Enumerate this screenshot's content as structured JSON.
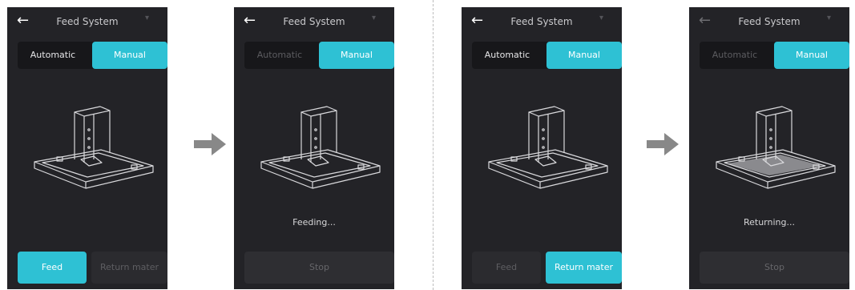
{
  "header": {
    "title": "Feed System",
    "back_icon": "←",
    "wifi_icon": "wifi-icon"
  },
  "tabs": {
    "automatic": "Automatic",
    "manual": "Manual"
  },
  "buttons": {
    "feed": "Feed",
    "return_material": "Return mater",
    "stop": "Stop"
  },
  "status": {
    "feeding": "Feeding...",
    "returning": "Returning..."
  },
  "colors": {
    "accent": "#2ec1d4",
    "screen_bg": "#232327",
    "step_arrow": "#888888"
  }
}
